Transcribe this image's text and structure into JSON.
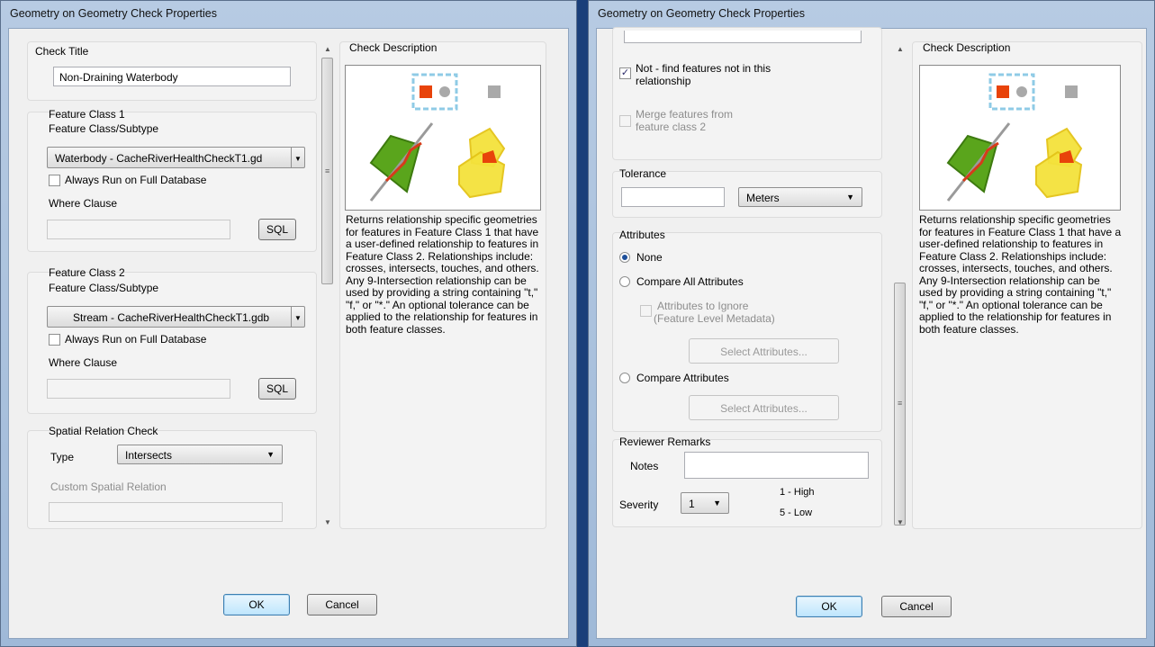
{
  "left_dialog": {
    "title": "Geometry on Geometry Check Properties",
    "check_title": {
      "group_label": "Check Title",
      "value": "Non-Draining Waterbody"
    },
    "fc1": {
      "group_label": "Feature Class 1",
      "subtype_label": "Feature Class/Subtype",
      "selected": "Waterbody - CacheRiverHealthCheckT1.gd",
      "always_run": "Always Run on Full Database",
      "where_label": "Where Clause",
      "sql": "SQL"
    },
    "fc2": {
      "group_label": "Feature Class 2",
      "subtype_label": "Feature Class/Subtype",
      "selected": "Stream - CacheRiverHealthCheckT1.gdb",
      "always_run": "Always Run on Full Database",
      "where_label": "Where Clause",
      "sql": "SQL"
    },
    "spatial": {
      "group_label": "Spatial Relation Check",
      "type_label": "Type",
      "type_value": "Intersects",
      "custom_label": "Custom Spatial Relation"
    },
    "description": {
      "label": "Check Description",
      "text": "Returns relationship specific geometries for features in Feature Class 1 that have a user-defined relationship to features in Feature Class 2.  Relationships include: crosses, intersects, touches, and others.  Any 9-Intersection relationship can be used by providing a string containing \"t,\" \"f,\" or \"*.\"  An optional tolerance can be applied to the relationship for features in both feature classes."
    },
    "ok": "OK",
    "cancel": "Cancel"
  },
  "right_dialog": {
    "title": "Geometry on Geometry Check Properties",
    "not_find": {
      "line1": "Not - find features not in this",
      "line2": "relationship",
      "checked": true
    },
    "merge": {
      "line1": "Merge features  from",
      "line2": "feature class 2"
    },
    "tolerance": {
      "group_label": "Tolerance",
      "value": "",
      "unit": "Meters"
    },
    "attributes": {
      "group_label": "Attributes",
      "none": "None",
      "compare_all": "Compare All Attributes",
      "ignore_line1": "Attributes to Ignore",
      "ignore_line2": "(Feature Level Metadata)",
      "select1": "Select Attributes...",
      "compare": "Compare Attributes",
      "select2": "Select Attributes..."
    },
    "remarks": {
      "group_label": "Reviewer Remarks",
      "notes_label": "Notes",
      "severity_label": "Severity",
      "severity_value": "1",
      "high": "1 - High",
      "low": "5 - Low"
    },
    "description": {
      "label": "Check Description",
      "text": "Returns relationship specific geometries for features in Feature Class 1 that have a user-defined relationship to features in Feature Class 2.  Relationships include: crosses, intersects, touches, and others.  Any 9-Intersection relationship can be used by providing a string containing \"t,\" \"f,\" or \"*.\"  An optional tolerance can be applied to the relationship for features in both feature classes."
    },
    "ok": "OK",
    "cancel": "Cancel"
  },
  "colors": {
    "accent": "#e8430a",
    "polygon_green": "#5aa51c",
    "polygon_yellow": "#f4e23c",
    "dashed_blue": "#8fcbe6"
  }
}
